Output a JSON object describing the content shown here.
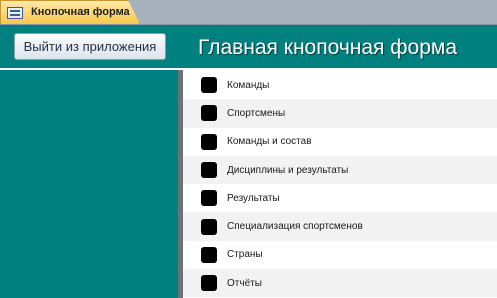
{
  "tab": {
    "label": "Кнопочная форма",
    "icon": "form-icon"
  },
  "header": {
    "exit_button_label": "Выйти из приложения",
    "title": "Главная кнопочная форма"
  },
  "colors": {
    "teal": "#00807f",
    "tab_gold": "#f7c74a"
  },
  "menu": {
    "items": [
      {
        "label": "Команды"
      },
      {
        "label": "Спортсмены"
      },
      {
        "label": "Команды и состав"
      },
      {
        "label": "Дисциплины и результаты"
      },
      {
        "label": "Результаты"
      },
      {
        "label": "Специализация спортсменов"
      },
      {
        "label": "Страны"
      },
      {
        "label": "Отчёты"
      }
    ]
  }
}
